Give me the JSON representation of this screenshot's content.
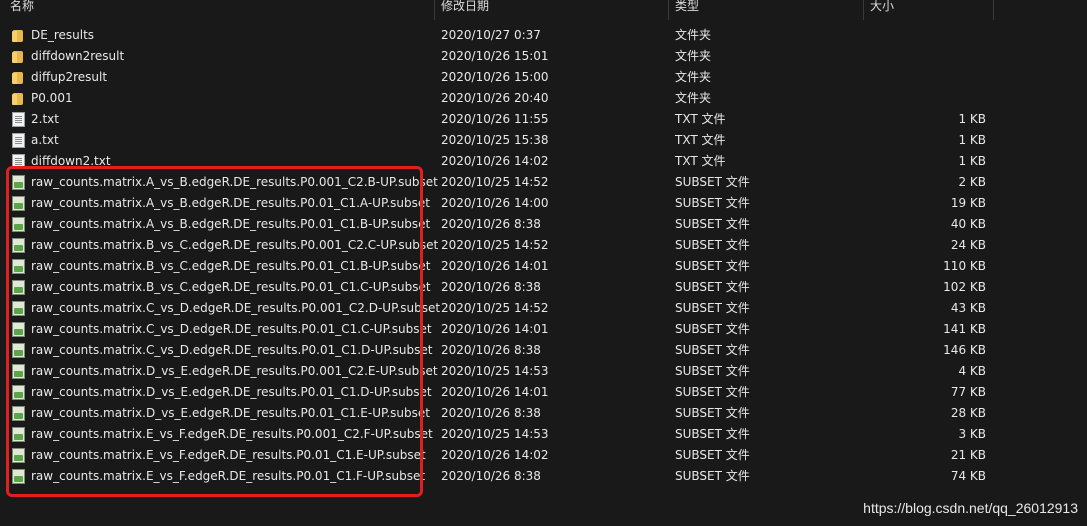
{
  "header": {
    "col_name": "名称",
    "col_date": "修改日期",
    "col_type": "类型",
    "col_size": "大小"
  },
  "files": [
    {
      "name": "DE_results",
      "date": "2020/10/27 0:37",
      "type": "文件夹",
      "size": "",
      "icon": "folder-icon"
    },
    {
      "name": "diffdown2result",
      "date": "2020/10/26 15:01",
      "type": "文件夹",
      "size": "",
      "icon": "folder-icon"
    },
    {
      "name": "diffup2result",
      "date": "2020/10/26 15:00",
      "type": "文件夹",
      "size": "",
      "icon": "folder-icon"
    },
    {
      "name": "P0.001",
      "date": "2020/10/26 20:40",
      "type": "文件夹",
      "size": "",
      "icon": "folder-icon"
    },
    {
      "name": "2.txt",
      "date": "2020/10/26 11:55",
      "type": "TXT 文件",
      "size": "1 KB",
      "icon": "text-file-icon"
    },
    {
      "name": "a.txt",
      "date": "2020/10/25 15:38",
      "type": "TXT 文件",
      "size": "1 KB",
      "icon": "text-file-icon"
    },
    {
      "name": "diffdown2.txt",
      "date": "2020/10/26 14:02",
      "type": "TXT 文件",
      "size": "1 KB",
      "icon": "text-file-icon"
    },
    {
      "name": "raw_counts.matrix.A_vs_B.edgeR.DE_results.P0.001_C2.B-UP.subset",
      "date": "2020/10/25 14:52",
      "type": "SUBSET 文件",
      "size": "2 KB",
      "icon": "subset-file-icon"
    },
    {
      "name": "raw_counts.matrix.A_vs_B.edgeR.DE_results.P0.01_C1.A-UP.subset",
      "date": "2020/10/26 14:00",
      "type": "SUBSET 文件",
      "size": "19 KB",
      "icon": "subset-file-icon"
    },
    {
      "name": "raw_counts.matrix.A_vs_B.edgeR.DE_results.P0.01_C1.B-UP.subset",
      "date": "2020/10/26 8:38",
      "type": "SUBSET 文件",
      "size": "40 KB",
      "icon": "subset-file-icon"
    },
    {
      "name": "raw_counts.matrix.B_vs_C.edgeR.DE_results.P0.001_C2.C-UP.subset",
      "date": "2020/10/25 14:52",
      "type": "SUBSET 文件",
      "size": "24 KB",
      "icon": "subset-file-icon"
    },
    {
      "name": "raw_counts.matrix.B_vs_C.edgeR.DE_results.P0.01_C1.B-UP.subset",
      "date": "2020/10/26 14:01",
      "type": "SUBSET 文件",
      "size": "110 KB",
      "icon": "subset-file-icon"
    },
    {
      "name": "raw_counts.matrix.B_vs_C.edgeR.DE_results.P0.01_C1.C-UP.subset",
      "date": "2020/10/26 8:38",
      "type": "SUBSET 文件",
      "size": "102 KB",
      "icon": "subset-file-icon"
    },
    {
      "name": "raw_counts.matrix.C_vs_D.edgeR.DE_results.P0.001_C2.D-UP.subset",
      "date": "2020/10/25 14:52",
      "type": "SUBSET 文件",
      "size": "43 KB",
      "icon": "subset-file-icon"
    },
    {
      "name": "raw_counts.matrix.C_vs_D.edgeR.DE_results.P0.01_C1.C-UP.subset",
      "date": "2020/10/26 14:01",
      "type": "SUBSET 文件",
      "size": "141 KB",
      "icon": "subset-file-icon"
    },
    {
      "name": "raw_counts.matrix.C_vs_D.edgeR.DE_results.P0.01_C1.D-UP.subset",
      "date": "2020/10/26 8:38",
      "type": "SUBSET 文件",
      "size": "146 KB",
      "icon": "subset-file-icon"
    },
    {
      "name": "raw_counts.matrix.D_vs_E.edgeR.DE_results.P0.001_C2.E-UP.subset",
      "date": "2020/10/25 14:53",
      "type": "SUBSET 文件",
      "size": "4 KB",
      "icon": "subset-file-icon"
    },
    {
      "name": "raw_counts.matrix.D_vs_E.edgeR.DE_results.P0.01_C1.D-UP.subset",
      "date": "2020/10/26 14:01",
      "type": "SUBSET 文件",
      "size": "77 KB",
      "icon": "subset-file-icon"
    },
    {
      "name": "raw_counts.matrix.D_vs_E.edgeR.DE_results.P0.01_C1.E-UP.subset",
      "date": "2020/10/26 8:38",
      "type": "SUBSET 文件",
      "size": "28 KB",
      "icon": "subset-file-icon"
    },
    {
      "name": "raw_counts.matrix.E_vs_F.edgeR.DE_results.P0.001_C2.F-UP.subset",
      "date": "2020/10/25 14:53",
      "type": "SUBSET 文件",
      "size": "3 KB",
      "icon": "subset-file-icon"
    },
    {
      "name": "raw_counts.matrix.E_vs_F.edgeR.DE_results.P0.01_C1.E-UP.subset",
      "date": "2020/10/26 14:02",
      "type": "SUBSET 文件",
      "size": "21 KB",
      "icon": "subset-file-icon"
    },
    {
      "name": "raw_counts.matrix.E_vs_F.edgeR.DE_results.P0.01_C1.F-UP.subset",
      "date": "2020/10/26 8:38",
      "type": "SUBSET 文件",
      "size": "74 KB",
      "icon": "subset-file-icon"
    }
  ],
  "annotation": {
    "highlight_color": "#e21e1e"
  },
  "watermark": "https://blog.csdn.net/qq_26012913",
  "colors": {
    "background": "#191919",
    "text": "#e8e8e8",
    "folder": "#e7b84a"
  }
}
